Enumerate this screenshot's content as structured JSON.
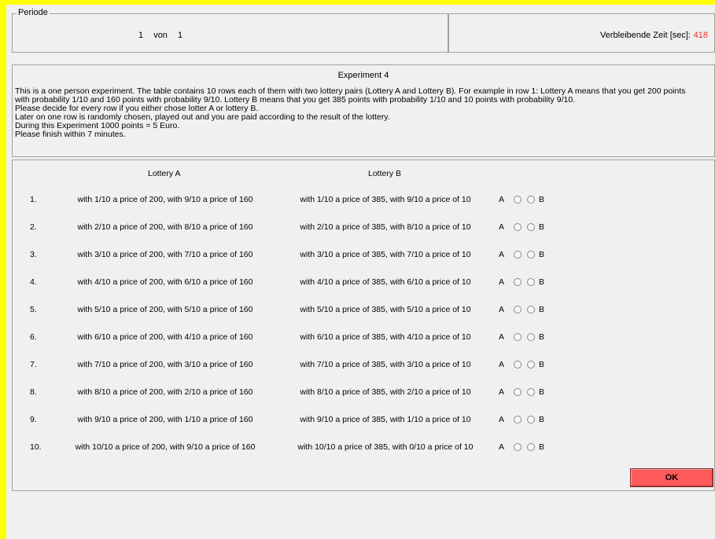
{
  "periode": {
    "legend": "Periode",
    "current": "1",
    "separator": "von",
    "total": "1"
  },
  "timer": {
    "label": "Verbleibende Zeit [sec]:",
    "value": "418",
    "value_color": "#e03030"
  },
  "instructions": {
    "title": "Experiment 4",
    "lines": [
      "This is a one person experiment. The table contains 10 rows each of them with two lottery pairs (Lottery A and Lottery B). For example in row 1: Lottery A means that you get 200 points",
      "with probability 1/10 and 160 points with probability 9/10. Lottery B means that you get 385 points with probability 1/10 and 10 points with probability 9/10.",
      "Please decide for every row if you either chose lotter A or lottery B.",
      "Later on one row is randomly chosen, played out and you are paid according to the result of the lottery.",
      "During this Experiment 1000 points = 5 Euro.",
      "Please finish within 7 minutes."
    ]
  },
  "table": {
    "header_a": "Lottery A",
    "header_b": "Lottery B",
    "option_a_label": "A",
    "option_b_label": "B",
    "rows": [
      {
        "num": "1.",
        "a": "with 1/10 a price of 200, with 9/10 a price of 160",
        "b": "with 1/10 a price of 385, with 9/10 a price of 10"
      },
      {
        "num": "2.",
        "a": "with 2/10 a price of 200, with 8/10 a price of 160",
        "b": "with 2/10 a price of 385, with 8/10 a price of 10"
      },
      {
        "num": "3.",
        "a": "with 3/10 a price of 200, with 7/10 a price of 160",
        "b": "with 3/10 a price of 385, with 7/10 a price of 10"
      },
      {
        "num": "4.",
        "a": "with 4/10 a price of 200, with 6/10 a price of 160",
        "b": "with 4/10 a price of 385, with 6/10 a price of 10"
      },
      {
        "num": "5.",
        "a": "with 5/10 a price of 200, with 5/10 a price of 160",
        "b": "with 5/10 a price of 385, with 5/10 a price of 10"
      },
      {
        "num": "6.",
        "a": "with 6/10 a price of 200, with 4/10 a price of 160",
        "b": "with 6/10 a price of 385, with 4/10 a price of 10"
      },
      {
        "num": "7.",
        "a": "with 7/10 a price of 200, with 3/10 a price of 160",
        "b": "with 7/10 a price of 385, with 3/10 a price of 10"
      },
      {
        "num": "8.",
        "a": "with 8/10 a price of 200, with 2/10 a price of 160",
        "b": "with 8/10 a price of 385, with 2/10 a price of 10"
      },
      {
        "num": "9.",
        "a": "with 9/10 a price of 200, with 1/10 a price of 160",
        "b": "with 9/10 a price of 385, with 1/10 a price of 10"
      },
      {
        "num": "10.",
        "a": "with 10/10 a price of 200, with 9/10 a price of 160",
        "b": "with 10/10 a price of 385, with 0/10 a price of 10"
      }
    ]
  },
  "ok_button": {
    "label": "OK",
    "color": "#ff5a5a"
  },
  "background_color": "#ffff00"
}
